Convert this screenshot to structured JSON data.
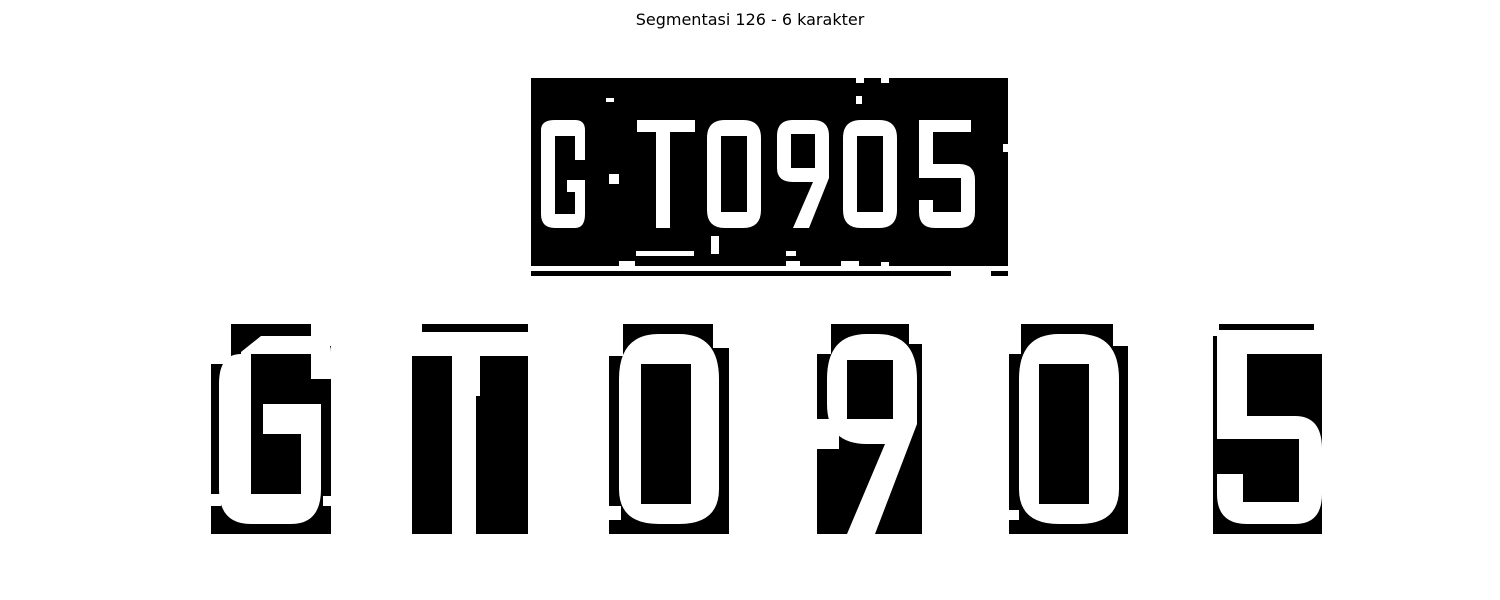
{
  "figure": {
    "title": "Segmentasi 126 - 6 karakter"
  },
  "plate": {
    "text": "G T0905",
    "foreground_color": "#ffffff",
    "background_color": "#000000"
  },
  "segments": [
    {
      "char": "G"
    },
    {
      "char": "T"
    },
    {
      "char": "0"
    },
    {
      "char": "9"
    },
    {
      "char": "0"
    },
    {
      "char": "5"
    }
  ]
}
